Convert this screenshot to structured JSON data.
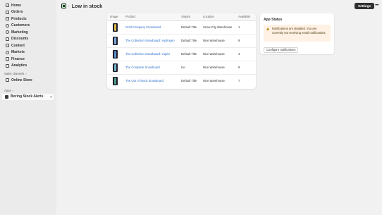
{
  "sidebar": {
    "items": [
      {
        "label": "Home",
        "icon": "home-icon"
      },
      {
        "label": "Orders",
        "icon": "orders-icon"
      },
      {
        "label": "Products",
        "icon": "tag-icon"
      },
      {
        "label": "Customers",
        "icon": "person-icon"
      },
      {
        "label": "Marketing",
        "icon": "target-icon"
      },
      {
        "label": "Discounts",
        "icon": "discount-icon"
      },
      {
        "label": "Content",
        "icon": "content-icon"
      },
      {
        "label": "Markets",
        "icon": "globe-icon"
      },
      {
        "label": "Finance",
        "icon": "bank-icon"
      },
      {
        "label": "Analytics",
        "icon": "chart-icon"
      }
    ],
    "sales_channels_label": "Sales channels",
    "online_store_label": "Online Store",
    "apps_label": "Apps",
    "app_label": "Boring Stock Alerts"
  },
  "header": {
    "title": "Low in stock",
    "settings_label": "Settings",
    "more_label": "•••"
  },
  "table": {
    "headers": {
      "image": "Image",
      "product": "Product",
      "variant": "Variant",
      "location": "Location",
      "available": "Available"
    },
    "rows": [
      {
        "product": "Gold Company Snowboard",
        "variant": "Default Title",
        "location": "Snow City Warehouse",
        "available": "1",
        "color": "#d9b44a"
      },
      {
        "product": "The Collection Snowboard: Hydrogen",
        "variant": "Default Title",
        "location": "Nice Warehouse",
        "available": "9",
        "color": "#7aa6d8"
      },
      {
        "product": "The Collection Snowboard: Liquid",
        "variant": "Default Title",
        "location": "Nice Warehouse",
        "available": "4",
        "color": "#5b8fc9"
      },
      {
        "product": "The Complete Snowboard",
        "variant": "Ice",
        "location": "Nice Warehouse",
        "available": "9",
        "color": "#6fb3c9"
      },
      {
        "product": "The Out of Stock Snowboard",
        "variant": "Default Title",
        "location": "Nice Warehouse",
        "available": "7",
        "color": "#4e9a8a"
      }
    ]
  },
  "status": {
    "title": "App Status",
    "message": "Notifications are disabled. You are currently not receiving email notifications.",
    "button_label": "Configure notifications"
  }
}
